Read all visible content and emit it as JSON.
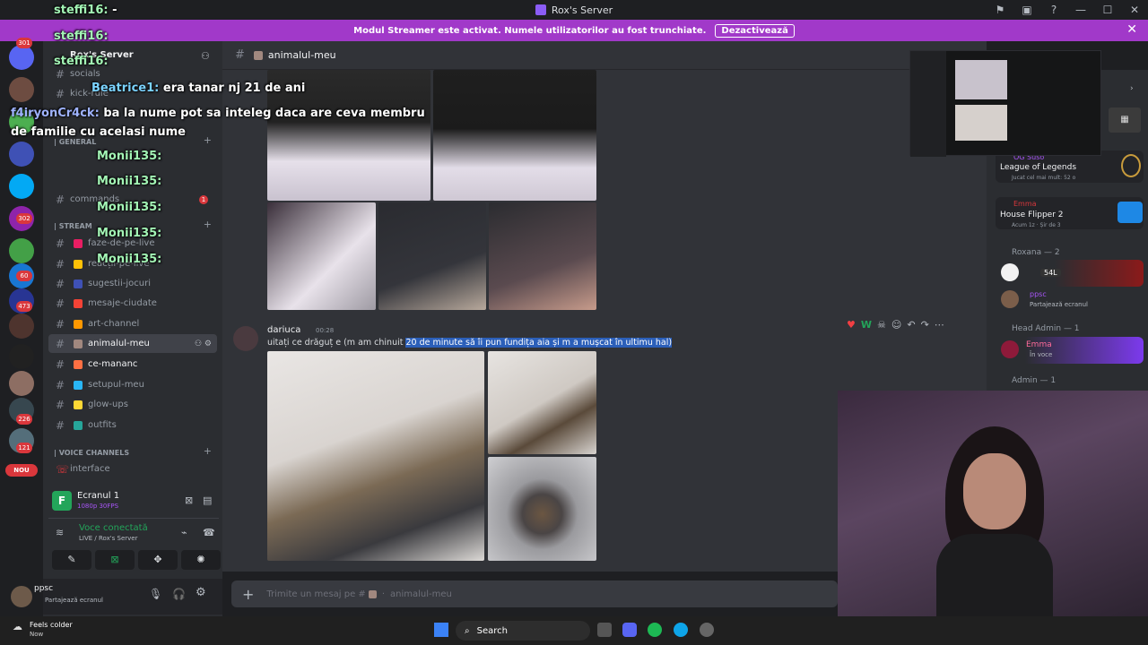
{
  "window": {
    "title": "Rox's Server"
  },
  "banner": {
    "text": "Modul Streamer este activat. Numele utilizatorilor au fost trunchiate.",
    "button": "Dezactivează",
    "close": "✕"
  },
  "rail": {
    "badges": [
      "301",
      "302",
      "60",
      "473",
      "226",
      "121"
    ],
    "new_label": "NOU"
  },
  "sidebar": {
    "server_name": "Rox's Server",
    "channels_top": [
      "socials",
      "kick-rule"
    ],
    "cat_general": "| GENERAL",
    "general_channels": [
      "commands"
    ],
    "cat_stream": "| STREAM",
    "stream_channels": [
      "faze-de-pe-live",
      "reacții-pe-live",
      "sugestii-jocuri",
      "mesaje-ciudate",
      "art-channel",
      "animalul-meu",
      "ce-mananc",
      "setupul-meu",
      "glow-ups",
      "outfits"
    ],
    "cat_voice": "| VOICE CHANNELS",
    "voice_channels": [
      "interface"
    ],
    "commands_badge": "1"
  },
  "stream_panel": {
    "title": "Ecranul 1",
    "subtitle": "1080p 30FPS",
    "voice_status": "Voce conectată",
    "voice_location": "LIVE / Rox's Server"
  },
  "user_panel": {
    "name": "ppsc",
    "status": "Partajează ecranul"
  },
  "chat": {
    "channel": "animalul-meu",
    "message_author": "dariuca",
    "message_time": "00:28",
    "message_text_plain": "uitați ce drăguț e (m am chinuit ",
    "message_text_selected": "20 de minute să îi pun fundița aia și m a mușcat în ultimu hal)",
    "composer_placeholder": "Trimite un mesaj pe #",
    "composer_channel": "animalul-meu"
  },
  "members": {
    "activity1_user": "OG Suso",
    "activity1_game": "League of Legends",
    "activity1_detail": "Jucat cel mai mult: 52 o",
    "activity2_user": "Emma",
    "activity2_game": "House Flipper 2",
    "activity2_detail": "Acum 1z · Șir de 3",
    "group_roxana": "Roxana — 2",
    "m1_name": "54L",
    "m2_name": "ppsc",
    "m2_status": "Partajează ecranul",
    "group_head_admin": "Head Admin — 1",
    "m3_name": "Emma",
    "m3_status": "În voce",
    "group_admin": "Admin — 1"
  },
  "overlay": {
    "lines": [
      {
        "name": "steffi16:",
        "text": "-"
      },
      {
        "name": "steffi16:",
        "text": ""
      },
      {
        "name": "steffi16:",
        "text": ""
      },
      {
        "name": "Beatrice1:",
        "text": "era tanar nj 21 de ani"
      },
      {
        "name": "f4iryonCr4ck:",
        "text": "ba la nume pot sa inteleg daca are ceva membru"
      },
      {
        "name": "",
        "text": "de familie cu acelasi nume"
      },
      {
        "name": "Monii135:",
        "text": ""
      },
      {
        "name": "Monii135:",
        "text": ""
      },
      {
        "name": "Monii135:",
        "text": ""
      },
      {
        "name": "Monii135:",
        "text": ""
      },
      {
        "name": "Monii135:",
        "text": ""
      }
    ]
  },
  "taskbar": {
    "weather_title": "Feels colder",
    "weather_sub": "Now",
    "search": "Search"
  },
  "colors": {
    "accent": "#a139c9",
    "online": "#23a55a",
    "danger": "#da373c"
  }
}
